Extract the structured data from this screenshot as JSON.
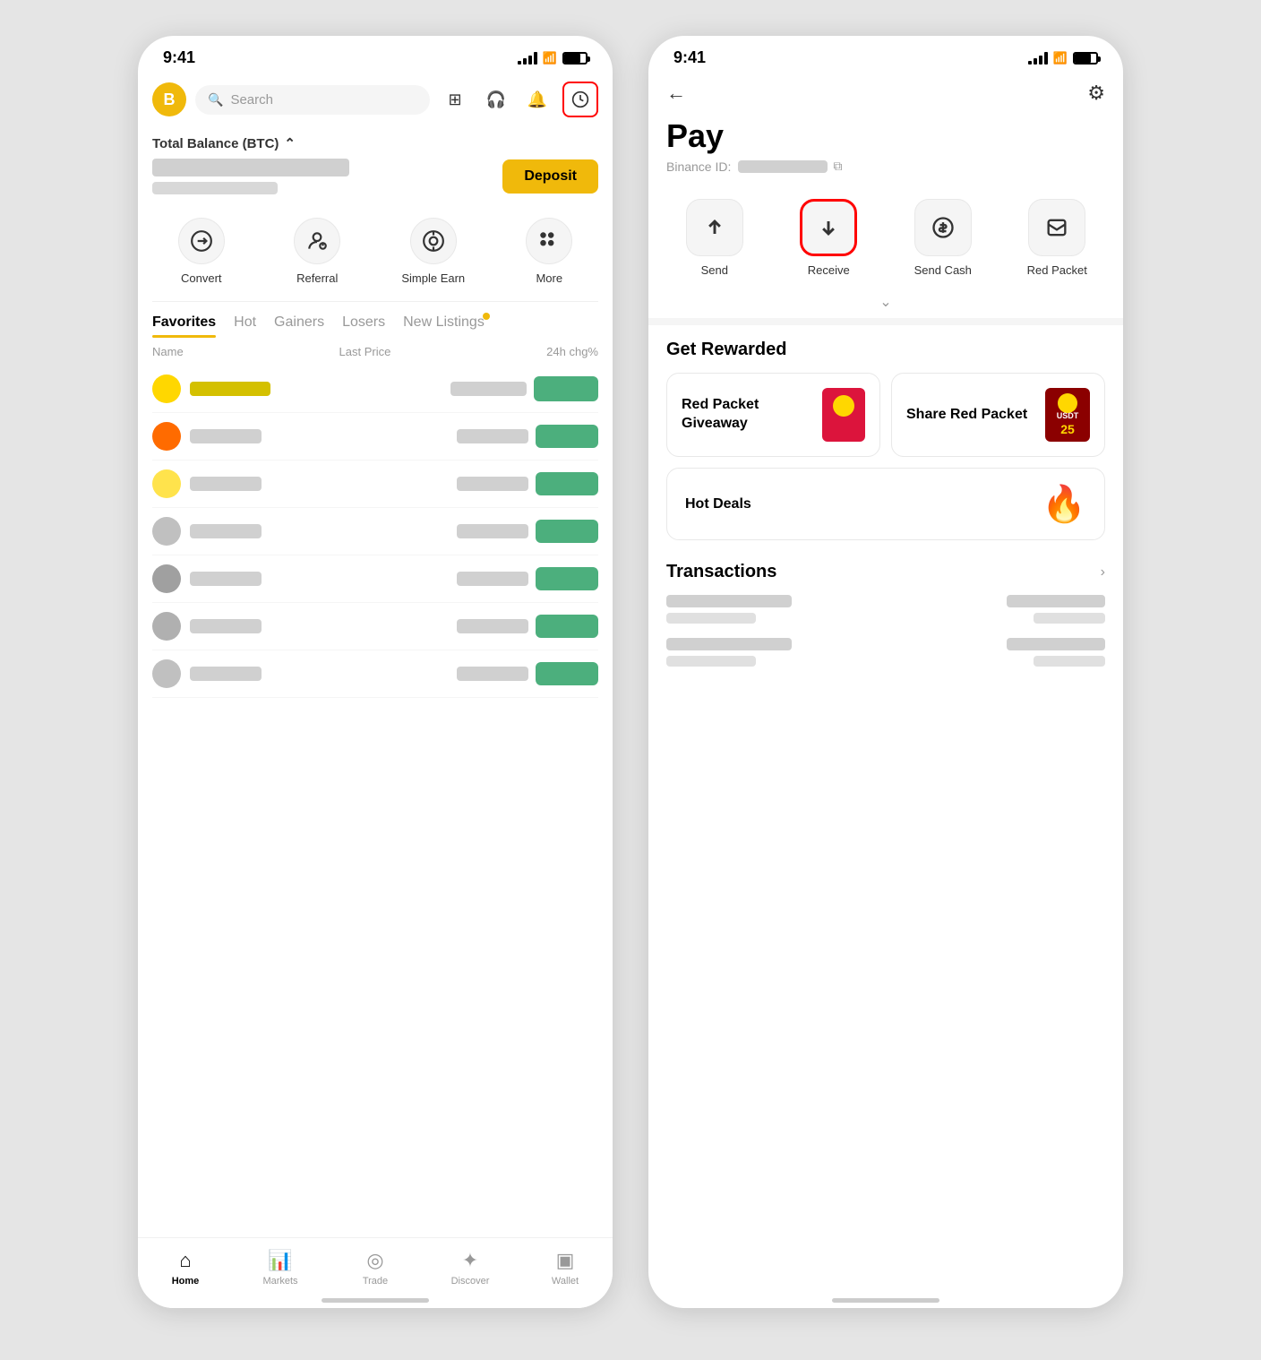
{
  "leftPhone": {
    "statusBar": {
      "time": "9:41"
    },
    "header": {
      "searchPlaceholder": "Search",
      "icons": [
        "scan-icon",
        "headset-icon",
        "bell-icon",
        "pay-icon"
      ]
    },
    "balance": {
      "title": "Total Balance (BTC)",
      "depositButton": "Deposit"
    },
    "quickActions": [
      {
        "id": "convert",
        "label": "Convert"
      },
      {
        "id": "referral",
        "label": "Referral"
      },
      {
        "id": "simple-earn",
        "label": "Simple Earn"
      },
      {
        "id": "more",
        "label": "More"
      }
    ],
    "tabs": [
      {
        "id": "favorites",
        "label": "Favorites",
        "active": true
      },
      {
        "id": "hot",
        "label": "Hot",
        "active": false
      },
      {
        "id": "gainers",
        "label": "Gainers",
        "active": false
      },
      {
        "id": "losers",
        "label": "Losers",
        "active": false
      },
      {
        "id": "new-listings",
        "label": "New Listings",
        "active": false,
        "badge": true
      }
    ],
    "marketHeader": {
      "nameCol": "Name",
      "priceCol": "Last Price",
      "changeCol": "24h chg%"
    },
    "bottomNav": [
      {
        "id": "home",
        "label": "Home",
        "active": true
      },
      {
        "id": "markets",
        "label": "Markets",
        "active": false
      },
      {
        "id": "trade",
        "label": "Trade",
        "active": false
      },
      {
        "id": "discover",
        "label": "Discover",
        "active": false
      },
      {
        "id": "wallet",
        "label": "Wallet",
        "active": false
      }
    ]
  },
  "rightPhone": {
    "statusBar": {
      "time": "9:41"
    },
    "header": {
      "backLabel": "←",
      "settingsLabel": "⚙"
    },
    "title": "Pay",
    "binanceId": {
      "label": "Binance ID:",
      "copyIcon": "copy"
    },
    "payActions": [
      {
        "id": "send",
        "label": "Send",
        "highlighted": false
      },
      {
        "id": "receive",
        "label": "Receive",
        "highlighted": true
      },
      {
        "id": "send-cash",
        "label": "Send Cash",
        "highlighted": false
      },
      {
        "id": "red-packet",
        "label": "Red Packet",
        "highlighted": false
      }
    ],
    "getRewardedSection": {
      "title": "Get Rewarded",
      "rewards": [
        {
          "id": "red-packet-giveaway",
          "label": "Red Packet Giveaway"
        },
        {
          "id": "share-red-packet",
          "label": "Share Red Packet"
        }
      ],
      "hotDeals": {
        "id": "hot-deals",
        "label": "Hot Deals"
      }
    },
    "transactionsSection": {
      "title": "Transactions"
    }
  }
}
